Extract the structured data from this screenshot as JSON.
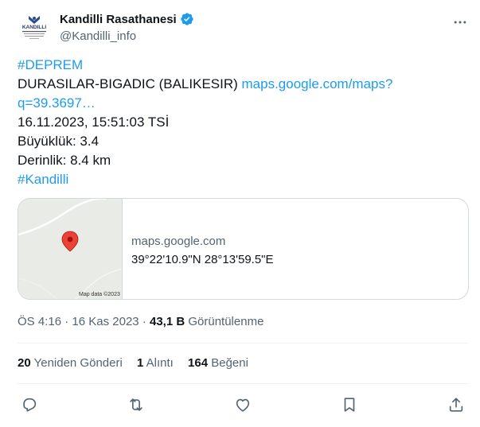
{
  "author": {
    "display_name": "Kandilli Rasathanesi",
    "handle": "@Kandilli_info",
    "avatar_text": "KANDILLI"
  },
  "tweet": {
    "hashtag1": "#DEPREM",
    "location": "DURASILAR-BIGADIC (BALIKESIR)",
    "link_part1": "maps.google.com/maps?",
    "link_part2": "q=39.3697…",
    "datetime": "16.11.2023, 15:51:03 TSİ",
    "magnitude": "Büyüklük: 3.4",
    "depth": "Derinlik: 8.4 km",
    "hashtag2": "#Kandilli"
  },
  "card": {
    "domain": "maps.google.com",
    "coords": "39°22'10.9\"N 28°13'59.5\"E",
    "map_attribution": "Map data ©2023"
  },
  "meta": {
    "time": "ÖS 4:16",
    "date": "16 Kas 2023",
    "views_count": "43,1 B",
    "views_label": "Görüntülenme"
  },
  "stats": {
    "retweets_count": "20",
    "retweets_label": "Yeniden Gönderi",
    "quotes_count": "1",
    "quotes_label": "Alıntı",
    "likes_count": "164",
    "likes_label": "Beğeni"
  },
  "colors": {
    "link": "#1d9bf0",
    "text": "#0f1419",
    "secondary": "#536471",
    "border": "#cfd9de",
    "verified": "#1d9bf0",
    "pin": "#ea4335"
  }
}
